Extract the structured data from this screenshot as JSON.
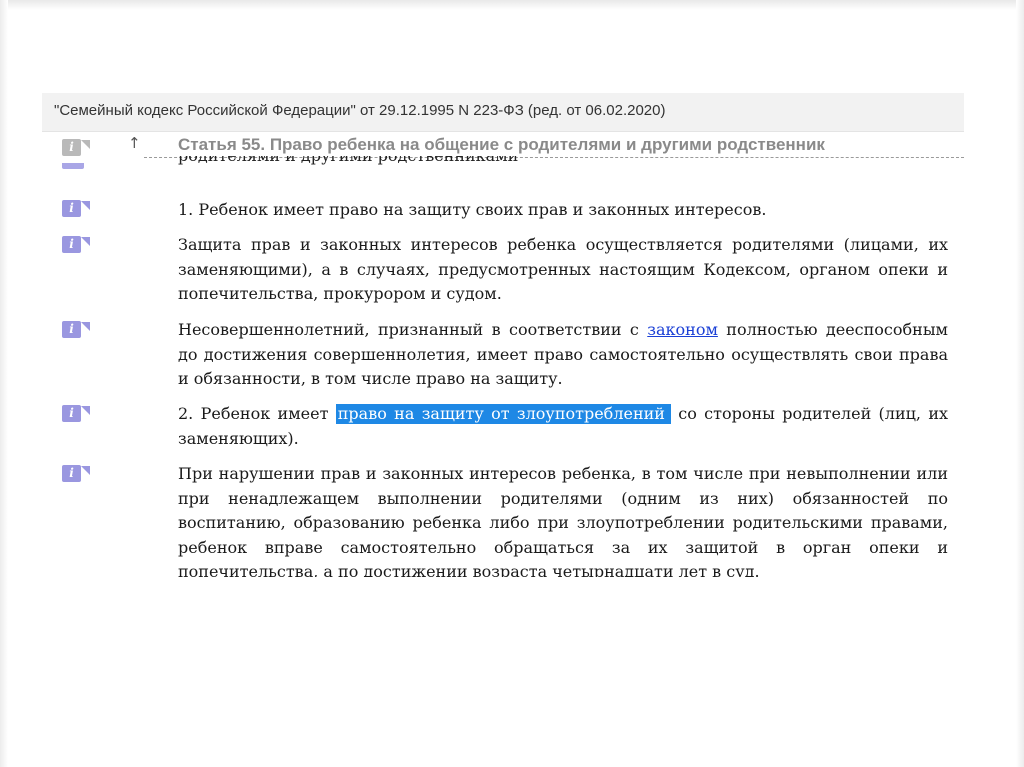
{
  "document": {
    "title": "\"Семейный кодекс Российской Федерации\" от 29.12.1995 N 223-ФЗ (ред. от 06.02.2020)",
    "article_title": "Статья 55. Право ребенка на общение с родителями и другими родственник",
    "up_arrow": "↑",
    "info_icon_label": "i",
    "cut_previous_line": "родителями и другими родственниками"
  },
  "paragraphs": [
    {
      "text": "1. Ребенок имеет право на защиту своих прав и законных интересов."
    },
    {
      "text": "Защита прав и законных интересов ребенка осуществляется родителями (лицами, их заменяющими), а в случаях, предусмотренных настоящим Кодексом, органом опеки и попечительства, прокурором и судом."
    },
    {
      "before_link": "Несовершеннолетний, признанный в соответствии с ",
      "link": "законом",
      "after_link": " полностью дееспособным до достижения совершеннолетия, имеет право самостоятельно осуществлять свои права и обязанности, в том числе право на защиту."
    },
    {
      "before_highlight": "2. Ребенок имеет ",
      "highlight": "право на защиту от злоупотреблений",
      "after_highlight": " со стороны родителей (лиц, их заменяющих)."
    },
    {
      "text": "При нарушении прав и законных интересов ребенка, в том числе при невыполнении или при ненадлежащем выполнении родителями (одним из них) обязанностей по воспитанию, образованию ребенка либо при злоупотреблении родительскими правами, ребенок вправе самостоятельно обращаться за их защитой в орган опеки и попечительства, а по достижении возраста четырнадцати лет в суд."
    }
  ],
  "colors": {
    "highlight": "#1e88e5",
    "link": "#1a3fd6",
    "info_icon": "#9a97e0",
    "info_icon_inactive": "#b9b9b9",
    "header_bg": "#f2f2f2"
  }
}
